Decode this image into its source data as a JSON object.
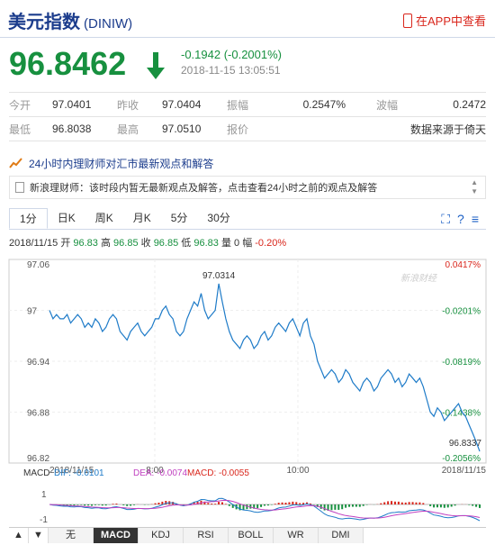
{
  "header": {
    "title": "美元指数",
    "code": "(DINIW)",
    "app_link": "在APP中查看"
  },
  "quote": {
    "price": "96.8462",
    "change": "-0.1942 (-0.2001%)",
    "time": "2018-11-15 13:05:51",
    "color": "#17903f"
  },
  "stats": {
    "row1": [
      {
        "label": "今开",
        "value": "97.0401"
      },
      {
        "label": "昨收",
        "value": "97.0404"
      },
      {
        "label": "振幅",
        "value": "0.2547%"
      },
      {
        "label": "波幅",
        "value": "0.2472"
      }
    ],
    "row2": [
      {
        "label": "最低",
        "value": "96.8038"
      },
      {
        "label": "最高",
        "value": "97.0510"
      },
      {
        "label": "报价",
        "value": "数据来源于倚天"
      }
    ]
  },
  "news": {
    "heading": "24小时内理财师对汇市最新观点和解答",
    "item": "新浪理财师：该时段内暂无最新观点及解答，点击查看24小时之前的观点及解答"
  },
  "tabs": [
    "1分",
    "日K",
    "周K",
    "月K",
    "5分",
    "30分"
  ],
  "info_line": {
    "date": "2018/11/15",
    "open_label": "开",
    "open": "96.83",
    "high_label": "高",
    "high": "96.85",
    "close_label": "收",
    "close": "96.85",
    "low_label": "低",
    "low": "96.83",
    "vol_label": "量",
    "vol": "0",
    "amp_label": "幅",
    "amp": "-0.20%"
  },
  "chart_data": {
    "type": "line",
    "watermark": "新浪财经",
    "y_ticks": [
      "97.06",
      "97",
      "96.94",
      "96.88",
      "96.82"
    ],
    "y_right_ticks": [
      "0.0417%",
      "-0.0201%",
      "-0.0819%",
      "-0.1438%",
      "-0.2056%"
    ],
    "x_ticks": [
      "2018/11/15",
      "8:00",
      "10:00",
      "2018/11/15"
    ],
    "annotations": {
      "high": "97.0314",
      "last": "96.8337"
    },
    "ylim": [
      96.82,
      97.06
    ],
    "series": [
      {
        "values": [
          97.0,
          96.99,
          96.995,
          96.99,
          96.99,
          96.995,
          96.985,
          96.99,
          96.995,
          96.99,
          96.98,
          96.985,
          96.98,
          96.99,
          96.985,
          96.975,
          96.98,
          96.99,
          96.995,
          96.99,
          96.975,
          96.97,
          96.965,
          96.975,
          96.98,
          96.985,
          96.975,
          96.97,
          96.975,
          96.98,
          96.99,
          96.99,
          97.0,
          97.005,
          96.995,
          96.99,
          96.975,
          96.97,
          96.975,
          96.99,
          97.0,
          97.01,
          97.005,
          97.02,
          97.0,
          96.99,
          96.995,
          97.0,
          97.0314,
          97.01,
          96.99,
          96.975,
          96.965,
          96.96,
          96.955,
          96.965,
          96.97,
          96.965,
          96.955,
          96.96,
          96.97,
          96.975,
          96.965,
          96.97,
          96.98,
          96.985,
          96.98,
          96.975,
          96.985,
          96.99,
          96.98,
          96.97,
          96.985,
          96.99,
          96.97,
          96.96,
          96.94,
          96.93,
          96.92,
          96.925,
          96.93,
          96.925,
          96.915,
          96.92,
          96.93,
          96.925,
          96.915,
          96.91,
          96.905,
          96.915,
          96.92,
          96.915,
          96.905,
          96.91,
          96.92,
          96.925,
          96.93,
          96.925,
          96.915,
          96.92,
          96.91,
          96.915,
          96.925,
          96.92,
          96.915,
          96.92,
          96.91,
          96.895,
          96.88,
          96.875,
          96.885,
          96.88,
          96.87,
          96.875,
          96.88,
          96.885,
          96.89,
          96.88,
          96.875,
          96.865,
          96.855,
          96.845,
          96.8337
        ]
      }
    ]
  },
  "macd": {
    "label": "MACD",
    "dif": "DIF: -0.0101",
    "dea": "DEA: -0.0074",
    "macd": "MACD: -0.0055",
    "y_ticks": [
      "1",
      "-1"
    ]
  },
  "indicator_tabs": [
    "无",
    "MACD",
    "KDJ",
    "RSI",
    "BOLL",
    "WR",
    "DMI"
  ]
}
